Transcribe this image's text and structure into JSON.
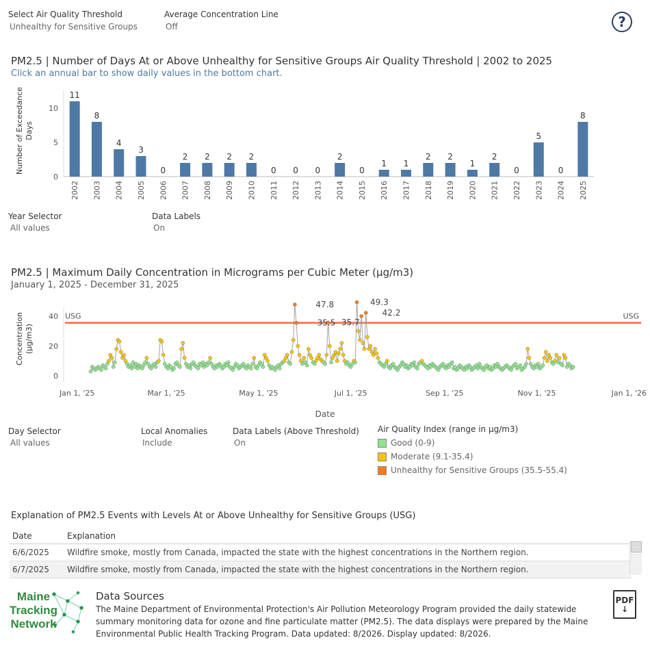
{
  "filters": {
    "threshold_label": "Select Air Quality Threshold",
    "threshold_value": "Unhealthy for Sensitive Groups",
    "avgline_label": "Average Concentration Line",
    "avgline_value": "Off",
    "help_glyph": "?",
    "year_label": "Year Selector",
    "year_value": "All values",
    "datalabels_label": "Data Labels",
    "datalabels_value": "On",
    "day_label": "Day Selector",
    "day_value": "All values",
    "anom_label": "Local Anomalies",
    "anom_value": "Include",
    "dlabove_label": "Data Labels (Above Threshold)",
    "dlabove_value": "On"
  },
  "bar_section": {
    "title": "PM2.5 | Number of Days At or Above Unhealthy for Sensitive Groups Air Quality Threshold  | 2002 to 2025",
    "subtitle": "Click an annual bar to show daily values in the bottom chart."
  },
  "line_section": {
    "title": "PM2.5 | Maximum Daily Concentration in Micrograms per Cubic Meter (µg/m3)",
    "subtitle": "January 1, 2025 - December 31, 2025"
  },
  "legend": {
    "title": "Air Quality Index (range in µg/m3)",
    "items": [
      {
        "label": "Good (0-9)",
        "color": "#8fe38f"
      },
      {
        "label": "Moderate (9.1-35.4)",
        "color": "#f6c40f"
      },
      {
        "label": "Unhealthy for Sensitive Groups (35.5-55.4)",
        "color": "#f47c20"
      }
    ]
  },
  "table": {
    "title": "Explanation of PM2.5 Events with Levels At or Above Unhealthy for Sensitive Groups (USG)",
    "headers": [
      "Date",
      "Explanation"
    ],
    "rows": [
      {
        "date": "6/6/2025",
        "text": "Wildfire smoke, mostly from Canada, impacted the state with the highest concentrations in the Northern region."
      },
      {
        "date": "6/7/2025",
        "text": "Wildfire smoke, mostly from Canada, impacted the state with the highest concentrations in the Northern region."
      }
    ]
  },
  "footer": {
    "logo_line1": "Maine",
    "logo_line2": "Tracking",
    "logo_line3": "Network",
    "ds_title": "Data Sources",
    "ds_body": "The Maine Department of Environmental Protection's Air Pollution Meteorology Program provided the daily statewide summary monitoring data for ozone and fine particulate matter (PM2.5). The data displays were prepared by the Maine Environmental Public Health Tracking Program. Data updated: 8/2026. Display updated: 8/2026.",
    "pdf_label": "PDF"
  },
  "colors": {
    "bar": "#4e79a7",
    "threshold": "#f47c5c",
    "good": "#8fe38f",
    "moderate": "#f6c40f",
    "usg": "#f47c20"
  },
  "chart_data": [
    {
      "type": "bar",
      "ylabel": "Number of Exceedance Days",
      "xlabel": "",
      "ylim": [
        0,
        12
      ],
      "yticks": [
        0,
        5,
        10
      ],
      "categories": [
        "2002",
        "2003",
        "2004",
        "2005",
        "2006",
        "2007",
        "2008",
        "2009",
        "2010",
        "2011",
        "2012",
        "2013",
        "2014",
        "2015",
        "2016",
        "2017",
        "2018",
        "2019",
        "2020",
        "2021",
        "2022",
        "2023",
        "2024",
        "2025"
      ],
      "values": [
        11,
        8,
        4,
        3,
        0,
        2,
        2,
        2,
        2,
        0,
        0,
        0,
        2,
        0,
        1,
        1,
        2,
        2,
        1,
        2,
        0,
        5,
        0,
        8
      ],
      "data_labels": true
    },
    {
      "type": "line",
      "xlabel": "Date",
      "ylabel": "Concentration (µg/m3)",
      "ylim": [
        0,
        50
      ],
      "yticks": [
        0,
        20,
        40
      ],
      "x_tick_labels": [
        "Jan 1, '25",
        "Mar 1, '25",
        "May 1, '25",
        "Jul 1, '25",
        "Sep 1, '25",
        "Nov 1, '25",
        "Jan 1, '26"
      ],
      "x_tick_dates": [
        "2025-01-01",
        "2025-03-01",
        "2025-05-01",
        "2025-07-01",
        "2025-09-01",
        "2025-11-01",
        "2026-01-01"
      ],
      "threshold": {
        "value": 35.5,
        "label": "USG"
      },
      "annotations": [
        {
          "date": "2025-06-06",
          "value": 47.8,
          "label": "47.8"
        },
        {
          "date": "2025-06-07",
          "value": 35.5,
          "label": "35.5"
        },
        {
          "date": "2025-06-23",
          "value": 35.7,
          "label": "35.7"
        },
        {
          "date": "2025-07-12",
          "value": 49.3,
          "label": "49.3"
        },
        {
          "date": "2025-07-20",
          "value": 42.2,
          "label": "42.2"
        }
      ],
      "series": [
        {
          "start": "2025-01-10",
          "values": [
            3,
            6,
            5,
            4,
            5,
            6,
            5,
            4,
            7,
            6,
            5,
            8,
            10,
            14,
            12,
            6,
            9,
            18,
            24,
            23,
            16,
            12,
            14,
            10,
            8,
            6,
            7,
            5,
            9,
            6,
            8,
            5,
            7,
            6,
            5,
            7,
            9,
            12,
            8,
            6,
            5,
            7,
            8,
            6,
            9,
            10,
            24,
            23,
            14,
            8,
            6,
            5,
            7,
            6,
            4,
            5,
            8,
            9,
            7,
            6,
            18,
            22,
            12,
            8,
            6,
            7,
            5,
            8,
            9,
            7,
            6,
            5,
            8,
            7,
            9,
            6,
            8,
            7,
            9,
            12,
            8,
            6,
            5,
            7,
            6,
            8,
            7,
            5,
            6,
            8,
            7,
            9,
            6,
            5,
            4,
            6,
            8,
            7,
            5,
            6,
            7,
            8,
            6,
            5,
            7,
            6,
            5,
            8,
            12,
            6,
            5,
            7,
            9,
            8,
            6,
            14,
            12,
            10,
            7,
            5,
            6,
            5,
            4,
            6,
            7,
            5,
            8,
            9,
            10,
            12,
            14,
            9,
            8,
            16,
            24,
            47.8,
            35.5,
            20,
            14,
            10,
            8,
            12,
            9,
            7,
            18,
            14,
            12,
            9,
            8,
            10,
            12,
            14,
            11,
            10,
            9,
            8,
            14,
            35.7,
            20,
            9,
            12,
            14,
            16,
            10,
            15,
            18,
            22,
            14,
            10,
            8,
            9,
            7,
            6,
            8,
            10,
            9,
            49.3,
            30,
            24,
            40,
            22,
            18,
            42.2,
            26,
            18,
            20,
            16,
            14,
            18,
            15,
            12,
            9,
            8,
            7,
            6,
            8,
            10,
            6,
            5,
            7,
            8,
            6,
            5,
            4,
            6,
            7,
            9,
            8,
            6,
            7,
            5,
            6,
            8,
            7,
            9,
            6,
            5,
            8,
            9,
            10,
            8,
            7,
            6,
            5,
            7,
            6,
            8,
            7,
            6,
            5,
            4,
            6,
            7,
            8,
            6,
            5,
            7,
            6,
            8,
            9,
            5,
            6,
            4,
            5,
            7,
            6,
            5,
            4,
            6,
            5,
            7,
            6,
            4,
            5,
            6,
            7,
            5,
            8,
            6,
            5,
            4,
            6,
            7,
            5,
            6,
            4,
            5,
            7,
            6,
            8,
            6,
            5,
            4,
            5,
            6,
            7,
            6,
            5,
            4,
            6,
            7,
            8,
            5,
            6,
            7,
            4,
            5,
            6,
            8,
            18,
            12,
            8,
            6,
            5,
            7,
            6,
            8,
            5,
            6,
            7,
            12,
            16,
            10,
            14,
            12,
            9,
            8,
            10,
            14,
            9,
            12,
            8,
            7,
            14,
            12,
            6,
            8,
            7,
            5,
            6
          ]
        }
      ]
    }
  ]
}
